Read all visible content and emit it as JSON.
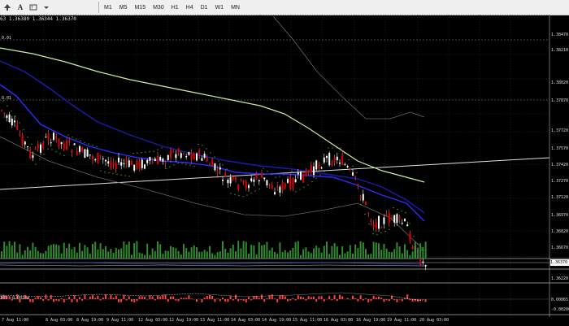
{
  "toolbar": {
    "timeframes": [
      "M1",
      "M5",
      "M15",
      "M30",
      "H1",
      "H4",
      "D1",
      "W1",
      "MN"
    ]
  },
  "chart": {
    "header": "63 1.36380 1.36344 1.36370",
    "fib_labels": [
      "0.01",
      "8.01"
    ],
    "indicator_label": "269 -0.00143",
    "current_price": "1.36370",
    "price_labels": [
      "1.38470",
      "1.38210",
      "1.38020",
      "1.37870",
      "1.37720",
      "1.37570",
      "1.37420",
      "1.37270",
      "1.37120",
      "1.36970",
      "1.36820",
      "1.36670",
      "1.36520",
      "1.36220"
    ],
    "indicator_axis_labels": [
      "0.00065",
      "-0.00206"
    ],
    "time_labels": [
      "7 Aug 11:00",
      "8 Aug 03:00",
      "8 Aug 19:00",
      "9 Aug 11:00",
      "12 Aug 03:00",
      "12 Aug 19:00",
      "13 Aug 11:00",
      "14 Aug 03:00",
      "14 Aug 19:00",
      "15 Aug 11:00",
      "16 Aug 03:00",
      "16 Aug 19:00",
      "19 Aug 11:00",
      "20 Aug 03:00"
    ],
    "colors": {
      "background": "#000000",
      "bull_candle": "#ffffff",
      "bear_candle": "#e00000",
      "ma_fast": "#2b2bff",
      "ma_mid": "#1a1ab0",
      "ma_slow": "#c8f0a0",
      "envelope": "#666666",
      "parabolic_sar": "#66cc33",
      "volume": "#2e8b2e",
      "trendline": "#e0e0e0",
      "macd_hist": "#ff4040"
    }
  }
}
